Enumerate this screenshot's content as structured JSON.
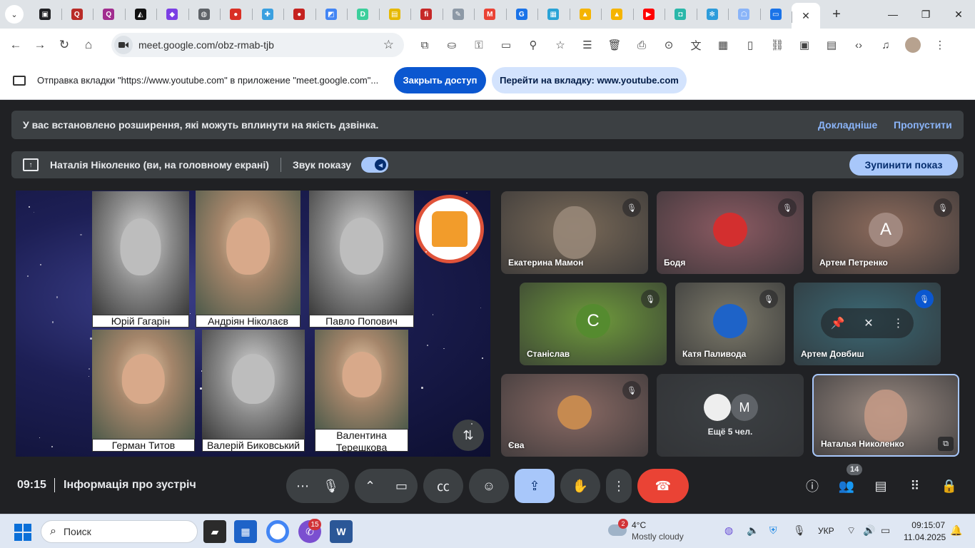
{
  "browser": {
    "tabs": [
      {
        "icon": "extensions-tab-icon",
        "color": "#202124",
        "glyph": "▣"
      },
      {
        "icon": "quora-icon",
        "color": "#b92b27",
        "glyph": "Q"
      },
      {
        "icon": "quora-icon",
        "color": "#a12d8f",
        "glyph": "Q"
      },
      {
        "icon": "prism-icon",
        "color": "#111111",
        "glyph": "◭"
      },
      {
        "icon": "cube-icon",
        "color": "#7b3fe4",
        "glyph": "◆"
      },
      {
        "icon": "globe-icon",
        "color": "#5f6368",
        "glyph": "◍"
      },
      {
        "icon": "red-ball-icon",
        "color": "#d93025",
        "glyph": "●"
      },
      {
        "icon": "puzzle-app-icon",
        "color": "#3aa0e0",
        "glyph": "✚"
      },
      {
        "icon": "red-ball-icon",
        "color": "#c5221f",
        "glyph": "●"
      },
      {
        "icon": "rainbow-app-icon",
        "color": "#4285f4",
        "glyph": "◩"
      },
      {
        "icon": "d-app-icon",
        "color": "#3ccf9c",
        "glyph": "D"
      },
      {
        "icon": "photo-app-icon",
        "color": "#e6b800",
        "glyph": "▤"
      },
      {
        "icon": "fi-app-icon",
        "color": "#c62828",
        "glyph": "fi"
      },
      {
        "icon": "pencil-board-icon",
        "color": "#8d99a6",
        "glyph": "✎"
      },
      {
        "icon": "gmail-icon",
        "color": "#ea4335",
        "glyph": "M"
      },
      {
        "icon": "g-app-icon",
        "color": "#1a73e8",
        "glyph": "G"
      },
      {
        "icon": "grid-app-icon",
        "color": "#29a3d6",
        "glyph": "▦"
      },
      {
        "icon": "bell-app-icon",
        "color": "#f5b400",
        "glyph": "▲"
      },
      {
        "icon": "bell-app-icon",
        "color": "#f5b400",
        "glyph": "▲"
      },
      {
        "icon": "youtube-icon",
        "color": "#ff0000",
        "glyph": "▶"
      },
      {
        "icon": "chat-app-icon",
        "color": "#2ab7a9",
        "glyph": "◘"
      },
      {
        "icon": "snowflake-icon",
        "color": "#2d9cdb",
        "glyph": "✻"
      },
      {
        "icon": "robot-app-icon",
        "color": "#8ab4f8",
        "glyph": "☖"
      },
      {
        "icon": "meet-present-icon",
        "color": "#1a73e8",
        "glyph": "▭"
      }
    ],
    "active_tab_close": "✕",
    "new_tab": "+",
    "url": "meet.google.com/obz-rmab-tjb"
  },
  "infobar": {
    "message": "Отправка вкладки \"https://www.youtube.com\" в приложение \"meet.google.com\"...",
    "stop_sharing": "Закрыть доступ",
    "switch_tab": "Перейти на вкладку: www.youtube.com"
  },
  "notice": {
    "text": "У вас встановлено розширення, які можуть вплинути на якість дзвінка.",
    "learn_more": "Докладніше",
    "dismiss": "Пропустити"
  },
  "presenting": {
    "who": "Наталія Ніколенко (ви, на головному екрані)",
    "sound_label": "Звук показу",
    "sound_on": true,
    "stop_button": "Зупинити показ"
  },
  "slide": {
    "portraits": [
      {
        "caption": "Юрій Гагарін",
        "bw": true
      },
      {
        "caption": "Андріян Ніколаєв",
        "bw": false
      },
      {
        "caption": "Павло Попович",
        "bw": true
      },
      {
        "caption": "Герман Титов",
        "bw": false
      },
      {
        "caption": "Валерій Биковський",
        "bw": true
      },
      {
        "caption": "Валентина Терешкова",
        "bw": false
      }
    ]
  },
  "participants": [
    {
      "name": "Екатерина Мамон",
      "muted": true,
      "bg": "#7a6a58",
      "type": "video"
    },
    {
      "name": "Бодя",
      "muted": true,
      "bg": "#8b5a62",
      "type": "avatar",
      "avatar_bg": "#d32f2f",
      "initial": ""
    },
    {
      "name": "Артем Петренко",
      "muted": true,
      "bg": "#8d6b5c",
      "type": "avatar",
      "avatar_bg": "#a1887f",
      "initial": "A"
    },
    {
      "name": "Станіслав",
      "muted": true,
      "bg": "#6f9a3c",
      "type": "avatar",
      "avatar_bg": "#558b2f",
      "initial": "C"
    },
    {
      "name": "Катя Паливода",
      "muted": true,
      "bg": "#7d7a6a",
      "type": "avatar",
      "avatar_bg": "#1e63c8",
      "initial": ""
    },
    {
      "name": "Артем Довбиш",
      "muted": true,
      "bg": "#3b6874",
      "type": "hover",
      "avatar_bg": "",
      "initial": ""
    },
    {
      "name": "Єва",
      "muted": true,
      "bg": "#8a6a64",
      "type": "avatar",
      "avatar_bg": "#c68a50",
      "initial": ""
    },
    {
      "name": "",
      "muted": false,
      "bg": "#3c4043",
      "type": "more",
      "avatar_bg": "#5f6368",
      "initial": "M",
      "more_label": "Ещё 5 чел."
    },
    {
      "name": "Наталья Николенко",
      "muted": false,
      "bg": "#9b8b82",
      "type": "self",
      "avatar_bg": "",
      "initial": ""
    }
  ],
  "meetbar": {
    "time": "09:15",
    "meeting_info": "Інформація про зустріч",
    "participants_count": "14"
  },
  "taskbar": {
    "search_placeholder": "Поиск",
    "telegram_badge": "15",
    "weather_badge": "2",
    "temperature": "4°C",
    "weather": "Mostly cloudy",
    "language": "УКР",
    "time": "09:15:07",
    "date": "11.04.2025"
  }
}
